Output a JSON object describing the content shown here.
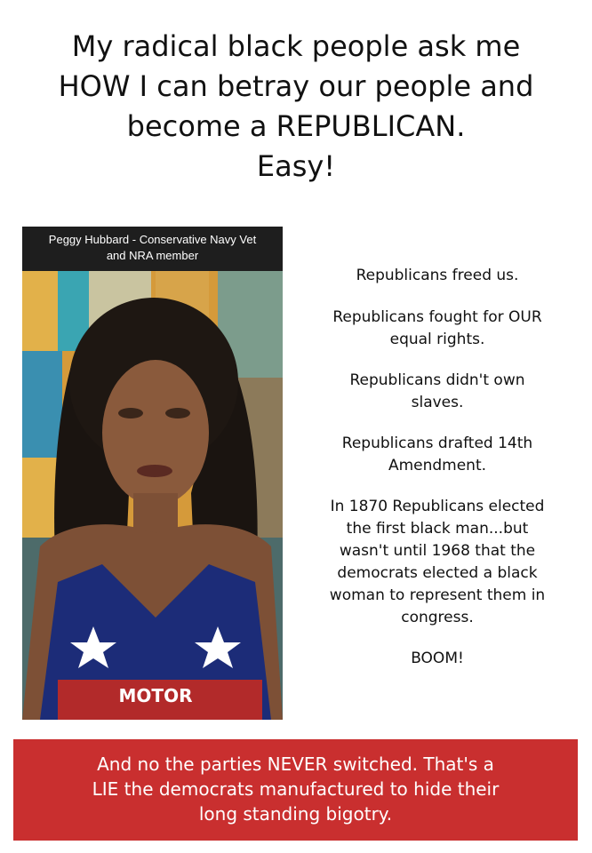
{
  "headline": {
    "lines": [
      "My radical black people ask me",
      "HOW I can betray our people and",
      "become a REPUBLICAN.",
      "Easy!"
    ]
  },
  "photo": {
    "caption_lines": [
      "Peggy Hubbard - Conservative Navy Vet",
      "and NRA member"
    ],
    "shirt_text": "MOTOR"
  },
  "points": [
    {
      "lines": [
        "Republicans freed us."
      ]
    },
    {
      "lines": [
        "Republicans fought for OUR",
        "equal rights."
      ]
    },
    {
      "lines": [
        "Republicans didn't own",
        "slaves."
      ]
    },
    {
      "lines": [
        "Republicans drafted 14th",
        "Amendment."
      ]
    },
    {
      "lines": [
        "In 1870 Republicans elected",
        "the first black man...but",
        "wasn't until 1968 that the",
        "democrats elected a black",
        "woman to represent them in",
        "congress."
      ]
    },
    {
      "lines": [
        "BOOM!"
      ]
    }
  ],
  "banner": {
    "lines": [
      "And no the parties NEVER switched. That's a",
      "LIE the democrats manufactured to hide their",
      "long standing bigotry."
    ],
    "color": "#c92f2f"
  }
}
